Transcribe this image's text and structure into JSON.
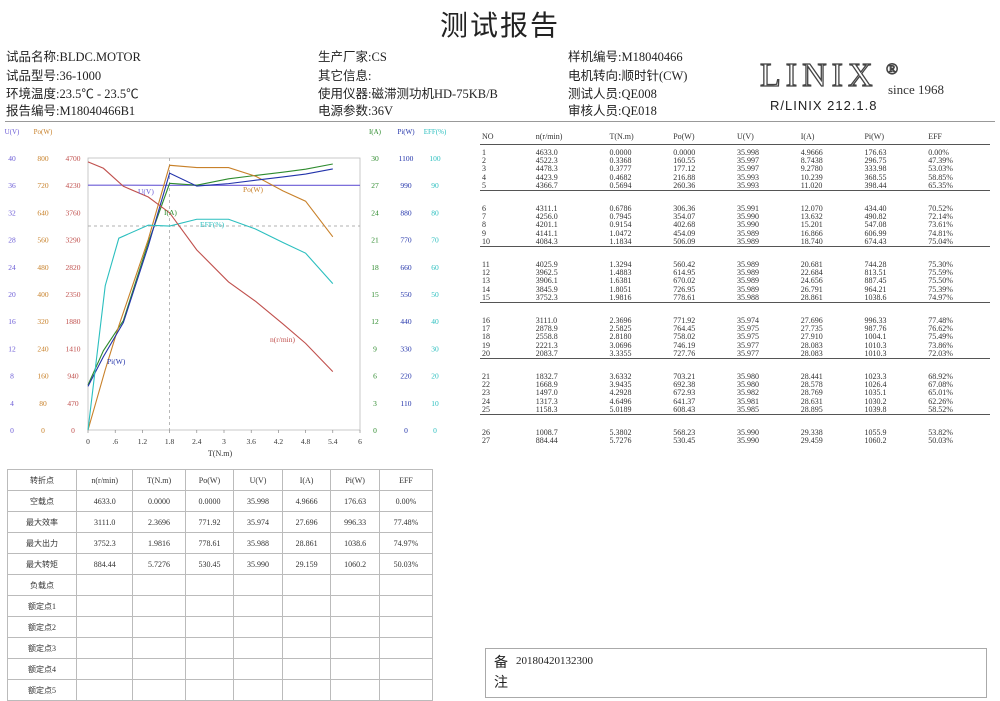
{
  "title": "测试报告",
  "info": [
    {
      "k": "试品名称:",
      "v": "BLDC.MOTOR"
    },
    {
      "k": "试品型号:",
      "v": "36-1000"
    },
    {
      "k": "环境温度:",
      "v": "23.5℃ - 23.5℃"
    },
    {
      "k": "报告编号:",
      "v": "M18040466B1"
    },
    {
      "k": "生产厂家:",
      "v": "CS"
    },
    {
      "k": "其它信息:",
      "v": ""
    },
    {
      "k": "使用仪器:",
      "v": "磁滞测功机HD-75KB/B"
    },
    {
      "k": "电源参数:",
      "v": "36V"
    },
    {
      "k": "样机编号:",
      "v": "M18040466"
    },
    {
      "k": "电机转向:",
      "v": "顺时针(CW)"
    },
    {
      "k": "测试人员:",
      "v": "QE008"
    },
    {
      "k": "审核人员:",
      "v": "QE018"
    }
  ],
  "logo": {
    "brand": "LINIX",
    "reg": "®",
    "since": "since 1968",
    "code": "R/LINIX 212.1.8"
  },
  "chart_data": {
    "type": "line",
    "xlabel": "T(N.m)",
    "x_ticks": [
      "0",
      ".6",
      "1.2",
      "1.8",
      "2.4",
      "3",
      "3.6",
      "4.2",
      "4.8",
      "5.4",
      "6"
    ],
    "xlim": [
      0,
      6
    ],
    "axes": [
      {
        "label": "U(V)",
        "color": "#6b5bd6",
        "ticks": [
          "0",
          "4",
          "8",
          "12",
          "16",
          "20",
          "24",
          "28",
          "32",
          "36",
          "40"
        ]
      },
      {
        "label": "Po(W)",
        "color": "#c8812a",
        "ticks": [
          "0",
          "80",
          "160",
          "240",
          "320",
          "400",
          "480",
          "560",
          "640",
          "720",
          "800"
        ]
      },
      {
        "label": "",
        "color": "#c0504d",
        "ticks": [
          "0",
          "470",
          "940",
          "1410",
          "1880",
          "2350",
          "2820",
          "3290",
          "3760",
          "4230",
          "4700"
        ]
      },
      {
        "label": "I(A)",
        "color": "#2e8b2e",
        "ticks": [
          "0",
          "3",
          "6",
          "9",
          "12",
          "15",
          "18",
          "21",
          "24",
          "27",
          "30"
        ]
      },
      {
        "label": "Pi(W)",
        "color": "#2233aa",
        "ticks": [
          "0",
          "110",
          "220",
          "330",
          "440",
          "550",
          "660",
          "770",
          "880",
          "990",
          "1100"
        ]
      },
      {
        "label": "EFF(%)",
        "color": "#2bbfbf",
        "ticks": [
          "0",
          "10",
          "20",
          "30",
          "40",
          "50",
          "60",
          "70",
          "80",
          "90",
          "100"
        ]
      }
    ],
    "curve_labels": {
      "U": "U(V)",
      "Po": "Po(W)",
      "I": "I(A)",
      "EFF": "EFF(%)",
      "N": "n(r/min)",
      "Pi": "Pi(W)"
    },
    "series": [
      {
        "name": "U(V)",
        "color": "#6b5bd6",
        "x": [
          0,
          1.8,
          2.4,
          6
        ],
        "y": [
          36,
          35.99,
          35.98,
          35.99
        ]
      },
      {
        "name": "I(A)",
        "color": "#2e8b2e",
        "x": [
          0,
          0.34,
          0.78,
          1.33,
          1.8,
          2.4,
          3.1,
          3.7,
          4.3,
          4.8,
          5.4
        ],
        "y": [
          4.97,
          8.75,
          12.07,
          20.68,
          27.2,
          27.0,
          27.7,
          28.08,
          28.44,
          28.77,
          29.34
        ]
      },
      {
        "name": "Po(W)",
        "color": "#c8812a",
        "x": [
          0,
          0.38,
          0.68,
          1.33,
          1.8,
          2.4,
          3.1,
          3.7,
          4.3,
          4.8,
          5.4
        ],
        "y": [
          0,
          177.12,
          306.36,
          560.42,
          778.61,
          771.92,
          771.92,
          746.19,
          703.21,
          672.93,
          568.23
        ]
      },
      {
        "name": "Pi(W)",
        "color": "#2233aa",
        "x": [
          0,
          0.34,
          0.78,
          1.33,
          1.8,
          2.4,
          3.1,
          3.7,
          4.3,
          4.8,
          5.4
        ],
        "y": [
          176.63,
          296.75,
          434.4,
          744.28,
          1038.6,
          986.33,
          996.33,
          1010.3,
          1023.3,
          1035.1,
          1055.9
        ]
      },
      {
        "name": "EFF(%)",
        "color": "#2bbfbf",
        "x": [
          0,
          0.38,
          0.68,
          1.33,
          1.8,
          2.4,
          3.1,
          3.7,
          4.3,
          4.8,
          5.4
        ],
        "y": [
          0,
          53.03,
          70.52,
          75.3,
          74.97,
          77.48,
          77.48,
          73.86,
          68.92,
          65.01,
          53.82
        ]
      },
      {
        "name": "n(r/min)",
        "color": "#c0504d",
        "x": [
          0,
          0.34,
          0.78,
          1.33,
          1.8,
          2.4,
          3.1,
          3.7,
          4.3,
          4.8,
          5.4
        ],
        "y": [
          4633,
          4522.3,
          4211.1,
          4025.9,
          3752.3,
          3111.0,
          2558.8,
          2221.3,
          1832.7,
          1497.0,
          1008.7
        ]
      }
    ]
  },
  "result_table": {
    "headers": [
      "NO",
      "n(r/min)",
      "T(N.m)",
      "Po(W)",
      "U(V)",
      "I(A)",
      "Pi(W)",
      "EFF"
    ],
    "groups": [
      [
        [
          "1",
          "4633.0",
          "0.0000",
          "0.0000",
          "35.998",
          "4.9666",
          "176.63",
          "0.00%"
        ],
        [
          "2",
          "4522.3",
          "0.3368",
          "160.55",
          "35.997",
          "8.7438",
          "296.75",
          "47.39%"
        ],
        [
          "3",
          "4478.3",
          "0.3777",
          "177.12",
          "35.997",
          "9.2780",
          "333.98",
          "53.03%"
        ],
        [
          "4",
          "4423.9",
          "0.4682",
          "216.88",
          "35.993",
          "10.239",
          "368.55",
          "58.85%"
        ],
        [
          "5",
          "4366.7",
          "0.5694",
          "260.36",
          "35.993",
          "11.020",
          "398.44",
          "65.35%"
        ]
      ],
      [
        [
          "6",
          "4311.1",
          "0.6786",
          "306.36",
          "35.991",
          "12.070",
          "434.40",
          "70.52%"
        ],
        [
          "7",
          "4256.0",
          "0.7945",
          "354.07",
          "35.990",
          "13.632",
          "490.82",
          "72.14%"
        ],
        [
          "8",
          "4201.1",
          "0.9154",
          "402.68",
          "35.990",
          "15.201",
          "547.08",
          "73.61%"
        ],
        [
          "9",
          "4141.1",
          "1.0472",
          "454.09",
          "35.989",
          "16.866",
          "606.99",
          "74.81%"
        ],
        [
          "10",
          "4084.3",
          "1.1834",
          "506.09",
          "35.989",
          "18.740",
          "674.43",
          "75.04%"
        ]
      ],
      [
        [
          "11",
          "4025.9",
          "1.3294",
          "560.42",
          "35.989",
          "20.681",
          "744.28",
          "75.30%"
        ],
        [
          "12",
          "3962.5",
          "1.4883",
          "614.95",
          "35.989",
          "22.684",
          "813.51",
          "75.59%"
        ],
        [
          "13",
          "3906.1",
          "1.6381",
          "670.02",
          "35.989",
          "24.656",
          "887.45",
          "75.50%"
        ],
        [
          "14",
          "3845.9",
          "1.8051",
          "726.95",
          "35.989",
          "26.791",
          "964.21",
          "75.39%"
        ],
        [
          "15",
          "3752.3",
          "1.9816",
          "778.61",
          "35.988",
          "28.861",
          "1038.6",
          "74.97%"
        ]
      ],
      [
        [
          "16",
          "3111.0",
          "2.3696",
          "771.92",
          "35.974",
          "27.696",
          "996.33",
          "77.48%"
        ],
        [
          "17",
          "2878.9",
          "2.5825",
          "764.45",
          "35.975",
          "27.735",
          "987.76",
          "76.62%"
        ],
        [
          "18",
          "2558.8",
          "2.8180",
          "758.02",
          "35.975",
          "27.910",
          "1004.1",
          "75.49%"
        ],
        [
          "19",
          "2221.3",
          "3.0696",
          "746.19",
          "35.977",
          "28.083",
          "1010.3",
          "73.86%"
        ],
        [
          "20",
          "2083.7",
          "3.3355",
          "727.76",
          "35.977",
          "28.083",
          "1010.3",
          "72.03%"
        ]
      ],
      [
        [
          "21",
          "1832.7",
          "3.6332",
          "703.21",
          "35.980",
          "28.441",
          "1023.3",
          "68.92%"
        ],
        [
          "22",
          "1668.9",
          "3.9435",
          "692.38",
          "35.980",
          "28.578",
          "1026.4",
          "67.08%"
        ],
        [
          "23",
          "1497.0",
          "4.2928",
          "672.93",
          "35.982",
          "28.769",
          "1035.1",
          "65.01%"
        ],
        [
          "24",
          "1317.3",
          "4.6496",
          "641.37",
          "35.981",
          "28.631",
          "1030.2",
          "62.26%"
        ],
        [
          "25",
          "1158.3",
          "5.0189",
          "608.43",
          "35.985",
          "28.895",
          "1039.8",
          "58.52%"
        ]
      ],
      [
        [
          "26",
          "1008.7",
          "5.3802",
          "568.23",
          "35.990",
          "29.338",
          "1055.9",
          "53.82%"
        ],
        [
          "27",
          "884.44",
          "5.7276",
          "530.45",
          "35.990",
          "29.459",
          "1060.2",
          "50.03%"
        ]
      ]
    ]
  },
  "summary_table": {
    "headers": [
      "转折点",
      "n(r/min)",
      "T(N.m)",
      "Po(W)",
      "U(V)",
      "I(A)",
      "Pi(W)",
      "EFF"
    ],
    "rows": [
      {
        "label": "空载点",
        "cells": [
          "4633.0",
          "0.0000",
          "0.0000",
          "35.998",
          "4.9666",
          "176.63",
          "0.00%"
        ]
      },
      {
        "label": "最大效率",
        "cells": [
          "3111.0",
          "2.3696",
          "771.92",
          "35.974",
          "27.696",
          "996.33",
          "77.48%"
        ]
      },
      {
        "label": "最大出力",
        "cells": [
          "3752.3",
          "1.9816",
          "778.61",
          "35.988",
          "28.861",
          "1038.6",
          "74.97%"
        ]
      },
      {
        "label": "最大转矩",
        "cells": [
          "884.44",
          "5.7276",
          "530.45",
          "35.990",
          "29.159",
          "1060.2",
          "50.03%"
        ]
      },
      {
        "label": "负载点",
        "cells": [
          "",
          "",
          "",
          "",
          "",
          "",
          ""
        ]
      },
      {
        "label": "额定点1",
        "cells": [
          "",
          "",
          "",
          "",
          "",
          "",
          ""
        ]
      },
      {
        "label": "额定点2",
        "cells": [
          "",
          "",
          "",
          "",
          "",
          "",
          ""
        ]
      },
      {
        "label": "额定点3",
        "cells": [
          "",
          "",
          "",
          "",
          "",
          "",
          ""
        ]
      },
      {
        "label": "额定点4",
        "cells": [
          "",
          "",
          "",
          "",
          "",
          "",
          ""
        ]
      },
      {
        "label": "额定点5",
        "cells": [
          "",
          "",
          "",
          "",
          "",
          "",
          ""
        ]
      }
    ]
  },
  "remarks": {
    "label": "备注",
    "value": "20180420132300"
  }
}
